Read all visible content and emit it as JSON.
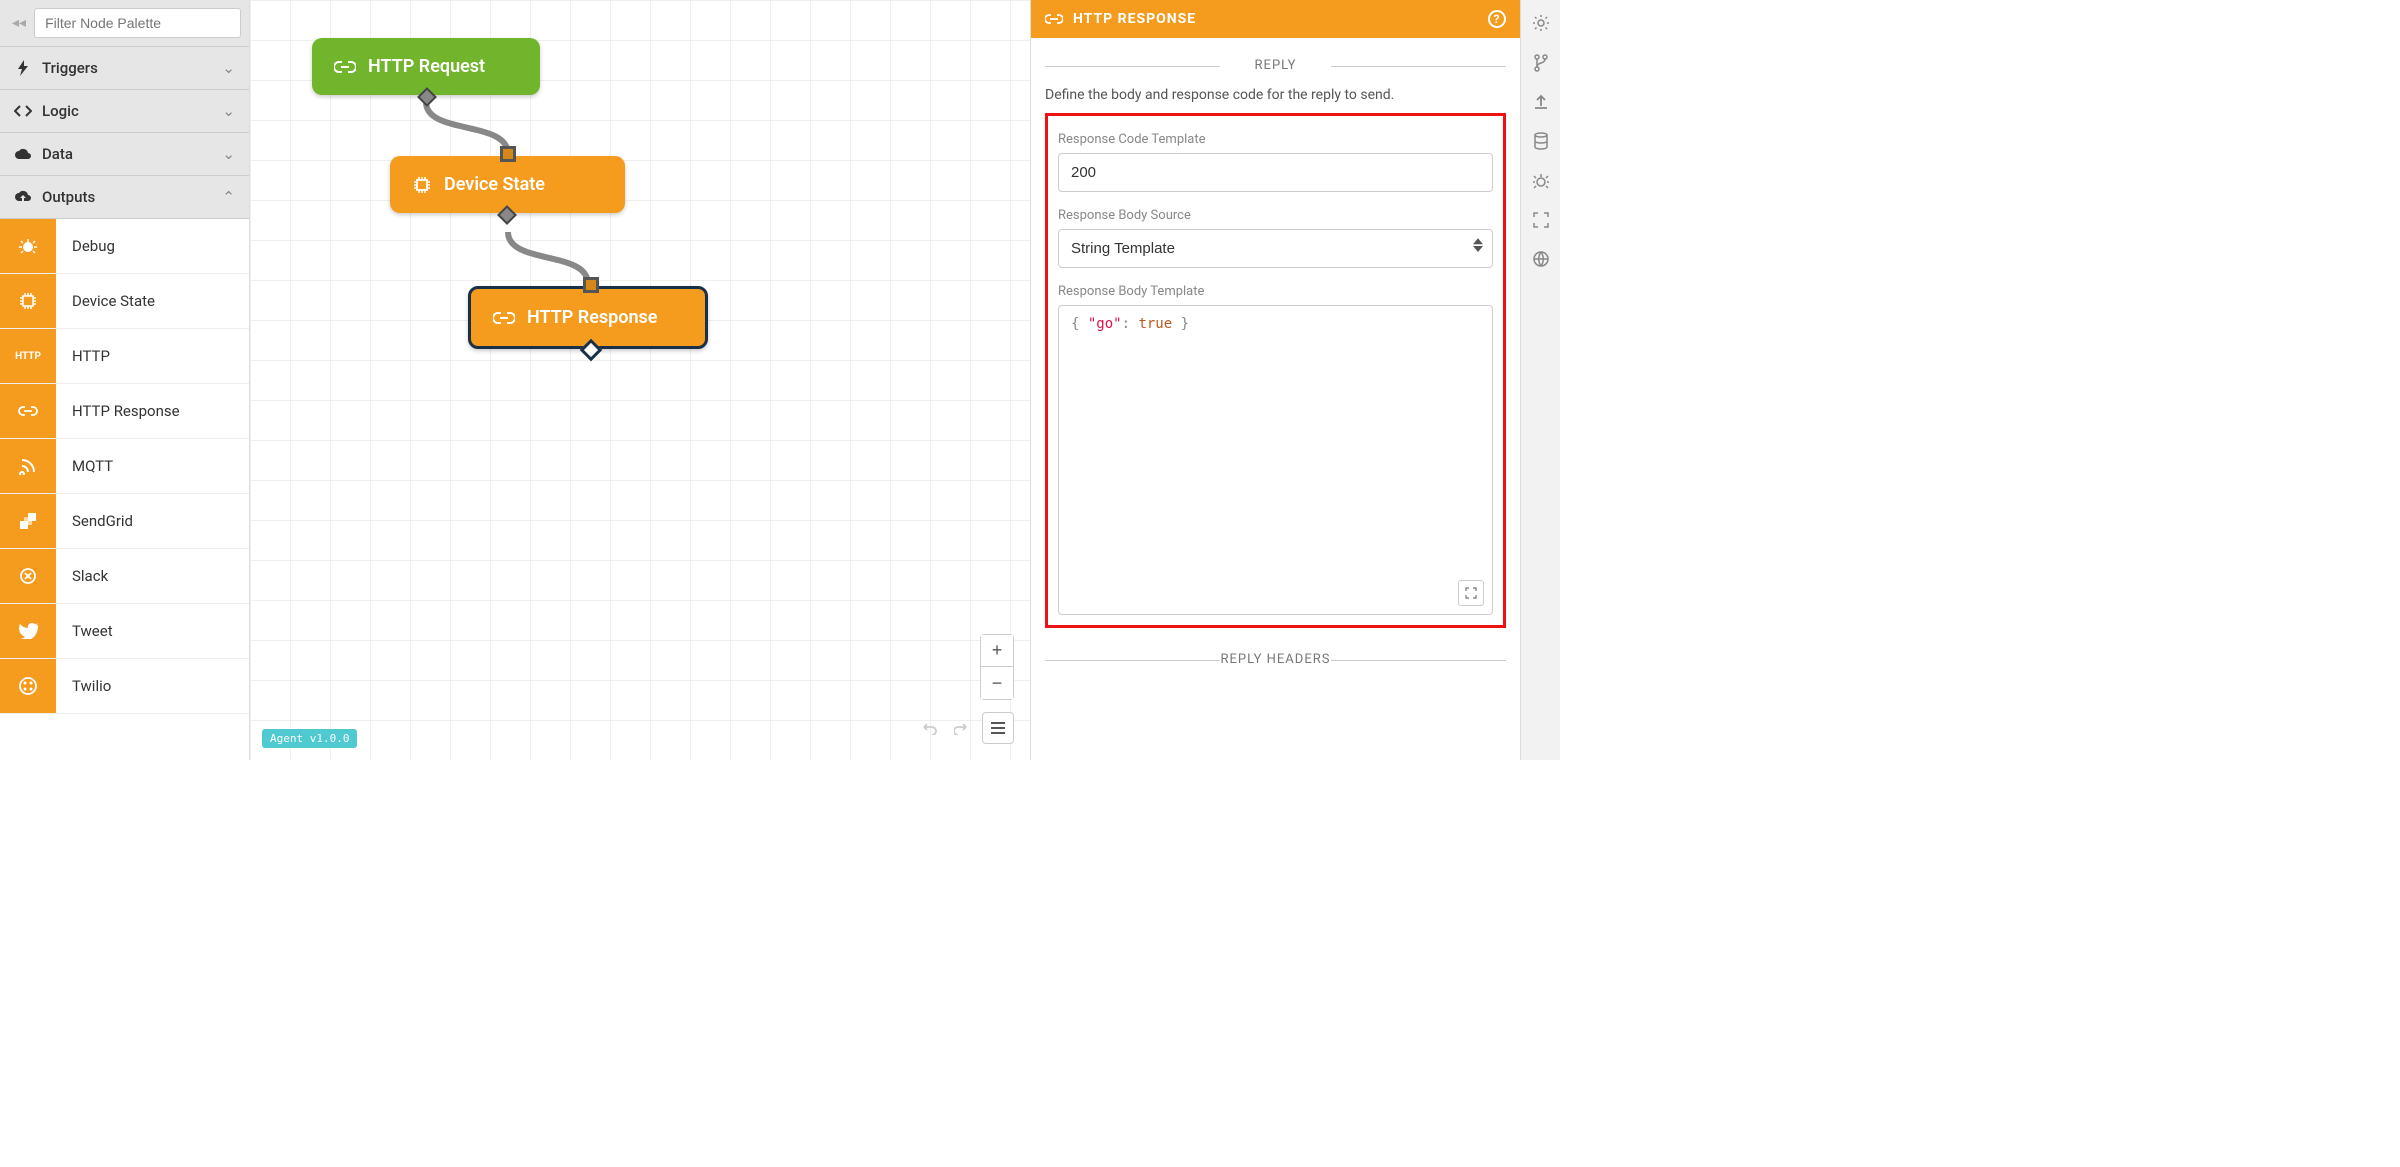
{
  "sidebar": {
    "filter_placeholder": "Filter Node Palette",
    "categories": [
      {
        "label": "Triggers",
        "expanded": false
      },
      {
        "label": "Logic",
        "expanded": false
      },
      {
        "label": "Data",
        "expanded": false
      },
      {
        "label": "Outputs",
        "expanded": true
      }
    ],
    "outputs": [
      {
        "label": "Debug"
      },
      {
        "label": "Device State"
      },
      {
        "label": "HTTP"
      },
      {
        "label": "HTTP Response"
      },
      {
        "label": "MQTT"
      },
      {
        "label": "SendGrid"
      },
      {
        "label": "Slack"
      },
      {
        "label": "Tweet"
      },
      {
        "label": "Twilio"
      }
    ]
  },
  "canvas": {
    "nodes": [
      {
        "label": "HTTP Request"
      },
      {
        "label": "Device State"
      },
      {
        "label": "HTTP Response"
      }
    ],
    "agent_tag": "Agent v1.0.0"
  },
  "panel": {
    "title": "HTTP RESPONSE",
    "section_reply": "REPLY",
    "description": "Define the body and response code for the reply to send.",
    "code_label": "Response Code Template",
    "code_value": "200",
    "body_source_label": "Response Body Source",
    "body_source_value": "String Template",
    "body_template_label": "Response Body Template",
    "body_template": {
      "brace_open": "{ ",
      "key": "\"go\"",
      "colon": ": ",
      "val": "true",
      "brace_close": " }"
    },
    "section_headers": "REPLY HEADERS"
  }
}
